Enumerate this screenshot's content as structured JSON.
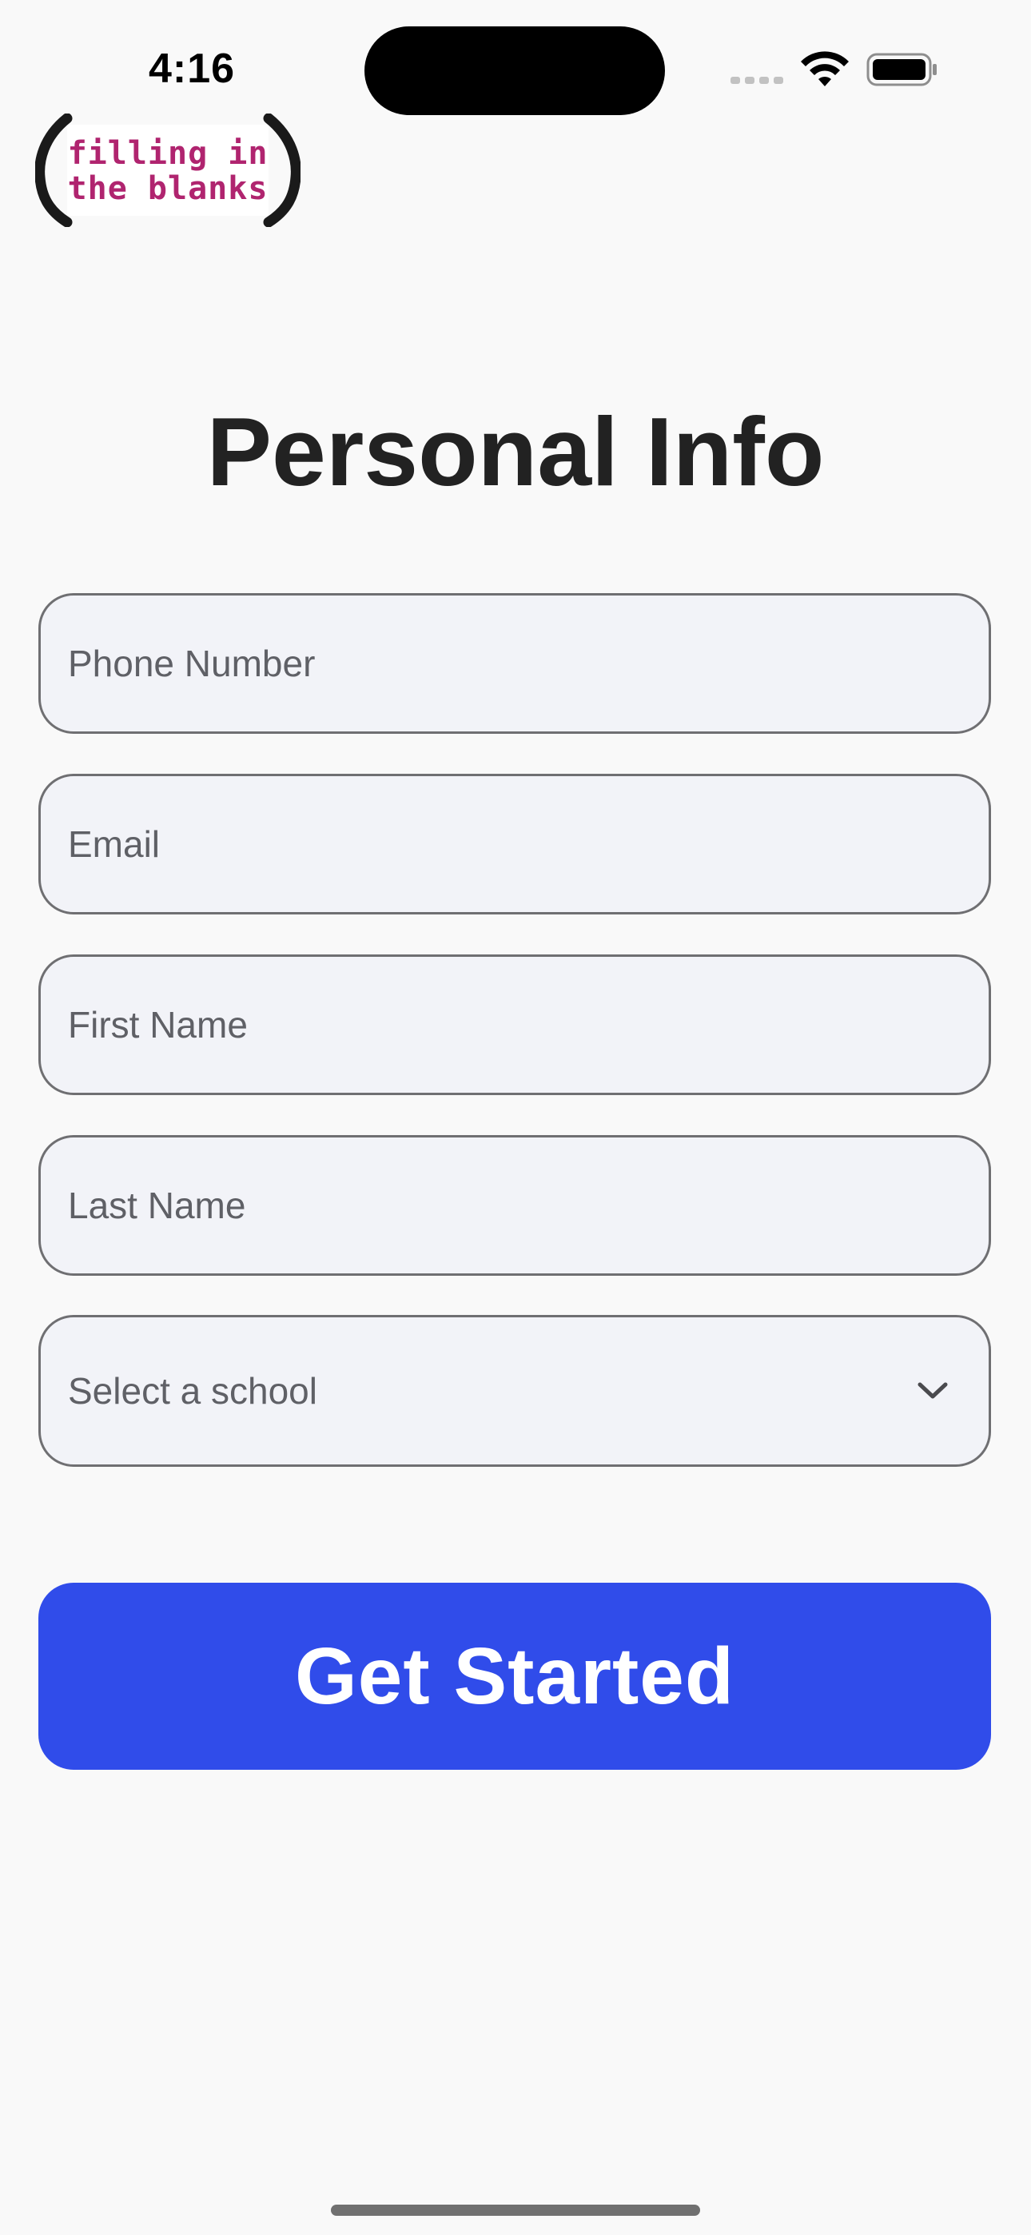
{
  "status_bar": {
    "time": "4:16"
  },
  "logo": {
    "line1": "filling in",
    "line2": "the blanks",
    "color": "#b0246f"
  },
  "page": {
    "title": "Personal Info"
  },
  "form": {
    "phone": {
      "placeholder": "Phone Number",
      "value": ""
    },
    "email": {
      "placeholder": "Email",
      "value": ""
    },
    "first_name": {
      "placeholder": "First Name",
      "value": ""
    },
    "last_name": {
      "placeholder": "Last Name",
      "value": ""
    },
    "school": {
      "selected": "Select a school",
      "icon": "chevron-down-icon"
    }
  },
  "actions": {
    "get_started_label": "Get Started"
  },
  "colors": {
    "accent": "#304cea",
    "title": "#222222",
    "field_bg": "#f2f3f8",
    "field_border": "#6f6f72"
  }
}
